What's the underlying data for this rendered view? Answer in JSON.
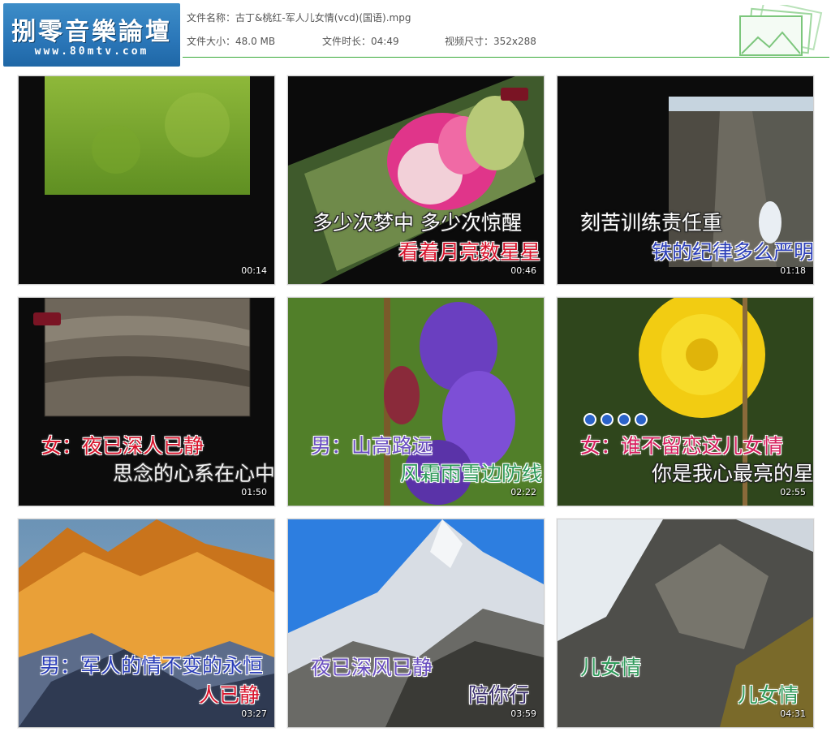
{
  "header": {
    "logo_cn": "捌零音樂論壇",
    "logo_url": "www.80mtv.com",
    "file_name": "文件名称：古丁&桃红-军人儿女情(vcd)(国语).mpg",
    "file_size": "文件大小：48.0 MB",
    "duration": "文件时长：04:49",
    "video_size": "视频尺寸：352x288"
  },
  "thumbnails": [
    {
      "time": "00:14",
      "line1": "",
      "line2": ""
    },
    {
      "time": "00:46",
      "line1": "多少次梦中 多少次惊醒",
      "line2": "看着月亮数星星"
    },
    {
      "time": "01:18",
      "line1": "刻苦训练责任重",
      "line2": "铁的纪律多么严明"
    },
    {
      "time": "01:50",
      "line1": "女：夜已深人已静",
      "line2": "思念的心系在心中"
    },
    {
      "time": "02:22",
      "line1": "男：山高路远",
      "line2": "风霜雨雪边防线"
    },
    {
      "time": "02:55",
      "line1": "女：谁不留恋这儿女情",
      "line2": "你是我心最亮的星"
    },
    {
      "time": "03:27",
      "line1": "男：军人的情不变的永恒",
      "line2": "人已静"
    },
    {
      "time": "03:59",
      "line1": "夜已深风已静",
      "line2": "陪你行"
    },
    {
      "time": "04:31",
      "line1": "儿女情",
      "line2": "儿女情"
    }
  ],
  "colors": {
    "accent_green": "#3aaa3a",
    "logo_blue": "#2a76b8",
    "lyric_red": "#d8142c",
    "lyric_blue": "#2c3fb8"
  }
}
